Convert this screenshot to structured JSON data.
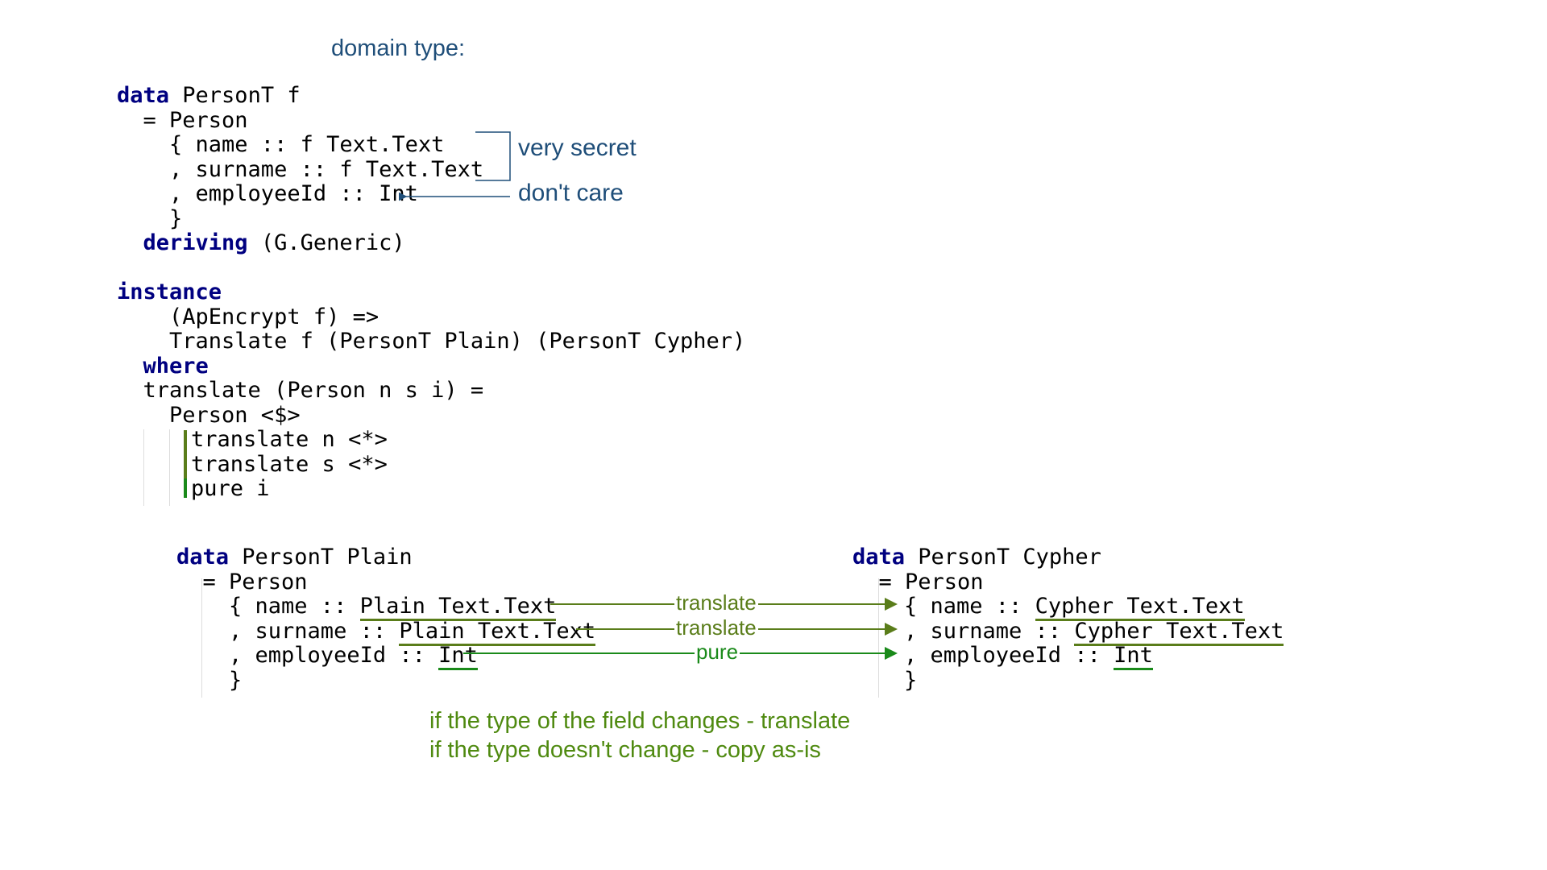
{
  "heading": "domain type:",
  "domain_code": {
    "l1_kw": "data",
    "l1_rest": " PersonT f",
    "l2": "  = Person",
    "l3": "    { name :: f Text.Text",
    "l4": "    , surname :: f Text.Text",
    "l5": "    , employeeId :: Int",
    "l6": "    }",
    "l7_kw": "deriving",
    "l7_rest": " (G.Generic)"
  },
  "annotations": {
    "very_secret": "very secret",
    "dont_care": "don't care"
  },
  "instance_code": {
    "l1_kw": "instance",
    "l2": "    (ApEncrypt f) =>",
    "l3": "    Translate f (PersonT Plain) (PersonT Cypher)",
    "l4_kw": "where",
    "l5": "  translate (Person n s i) =",
    "l6": "    Person <$>",
    "l7": "translate n <*>",
    "l8": "translate s <*>",
    "l9": "pure i"
  },
  "plain_code": {
    "l1_kw": "data",
    "l1_rest": " PersonT Plain",
    "l2": "  = Person",
    "l3_pre": "    { name :: ",
    "l3_type": "Plain Text.Text",
    "l4_pre": "    , surname :: ",
    "l4_type": "Plain Text.Text",
    "l5_pre": "    , employeeId :: ",
    "l5_type": "Int",
    "l6": "    }"
  },
  "cypher_code": {
    "l1_kw": "data",
    "l1_rest": " PersonT Cypher",
    "l2": "  = Person",
    "l3_pre": "{ name :: ",
    "l3_type": "Cypher Text.Text",
    "l4_pre": ", surname :: ",
    "l4_type": "Cypher Text.Text",
    "l5_pre": ", employeeId :: ",
    "l5_type": "Int",
    "l6": "}"
  },
  "arrow_labels": {
    "name": "translate",
    "surname": "translate",
    "employee": "pure"
  },
  "rules": {
    "line1": "if the type of the field changes - translate",
    "line2": "if the type doesn't change - copy as-is"
  },
  "colors": {
    "keyword": "#000080",
    "annotation": "#1f4e79",
    "translate_arrow": "#5a7d1a",
    "pure_arrow": "#1a8a1a",
    "note": "#4f8a10"
  }
}
